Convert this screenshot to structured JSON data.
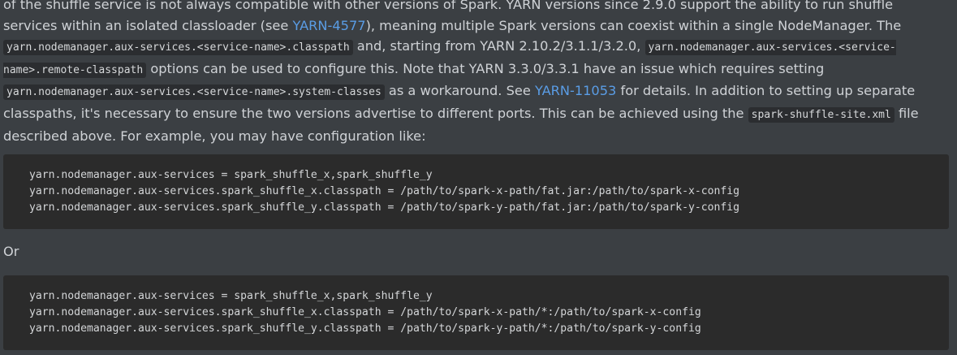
{
  "paragraph": {
    "t1": "of the shuffle service is not always compatible with other versions of Spark. YARN versions since 2.9.0 support the ability to run shuffle services within an isolated classloader (see ",
    "link1": "YARN-4577",
    "t2": "), meaning multiple Spark versions can coexist within a single NodeManager. The ",
    "code1": "yarn.nodemanager.aux-services.<service-name>.classpath",
    "t3": " and, starting from YARN 2.10.2/3.1.1/3.2.0, ",
    "code2": "yarn.nodemanager.aux-services.<service-name>.remote-classpath",
    "t4": " options can be used to configure this. Note that YARN 3.3.0/3.3.1 have an issue which requires setting ",
    "code3": "yarn.nodemanager.aux-services.<service-name>.system-classes",
    "t5": " as a workaround. See ",
    "link2": "YARN-11053",
    "t6": " for details. In addition to setting up separate classpaths, it's necessary to ensure the two versions advertise to different ports. This can be achieved using the ",
    "code4": "spark-shuffle-site.xml",
    "t7": " file described above. For example, you may have configuration like:"
  },
  "code_block_1": {
    "lines": [
      "yarn.nodemanager.aux-services = spark_shuffle_x,spark_shuffle_y",
      "yarn.nodemanager.aux-services.spark_shuffle_x.classpath = /path/to/spark-x-path/fat.jar:/path/to/spark-x-config",
      "yarn.nodemanager.aux-services.spark_shuffle_y.classpath = /path/to/spark-y-path/fat.jar:/path/to/spark-y-config"
    ]
  },
  "or_text": "Or",
  "code_block_2": {
    "lines": [
      "yarn.nodemanager.aux-services = spark_shuffle_x,spark_shuffle_y",
      "yarn.nodemanager.aux-services.spark_shuffle_x.classpath = /path/to/spark-x-path/*:/path/to/spark-x-config",
      "yarn.nodemanager.aux-services.spark_shuffle_y.classpath = /path/to/spark-y-path/*:/path/to/spark-y-config"
    ]
  },
  "colors": {
    "background": "#3b3f43",
    "code_block_background": "#2b2b2b",
    "link": "#5a9de6",
    "text": "#cfd2d6"
  }
}
